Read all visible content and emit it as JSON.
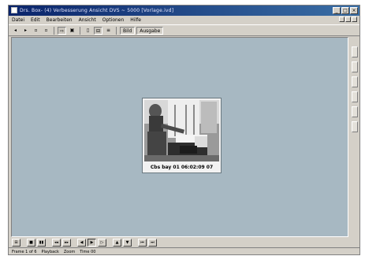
{
  "window": {
    "title": "Drs. Box-  (4)  Verbesserung Ansicht DVS ~ 5000  [Vorlage.ivd]",
    "minimize_glyph": "_",
    "maximize_glyph": "□",
    "close_glyph": "×"
  },
  "menu": [
    "Datei",
    "Edit",
    "Bearbeiten",
    "Ansicht",
    "Optionen",
    "Hilfe"
  ],
  "toolbar": {
    "buttons": [
      "◂",
      "▸",
      "▫",
      "▫",
      "⇨",
      "▣",
      "▯",
      "⊟",
      "≡",
      "▫"
    ],
    "wide_labels": [
      "Bild",
      "Ausgabe"
    ]
  },
  "video_frame": {
    "caption": "Cbs bay 01 06:02:09 07",
    "scene_icon": "camera-frame-image"
  },
  "controls": {
    "buttons": [
      "⊞",
      "■",
      "▮▮",
      "◂◂",
      "▸▸",
      "◀",
      "▶",
      "▷",
      "▲",
      "▼",
      "⏮",
      "⏭"
    ]
  },
  "status": [
    "Frame 1 of 6",
    "Playback",
    "Zoom",
    "Time 00"
  ]
}
